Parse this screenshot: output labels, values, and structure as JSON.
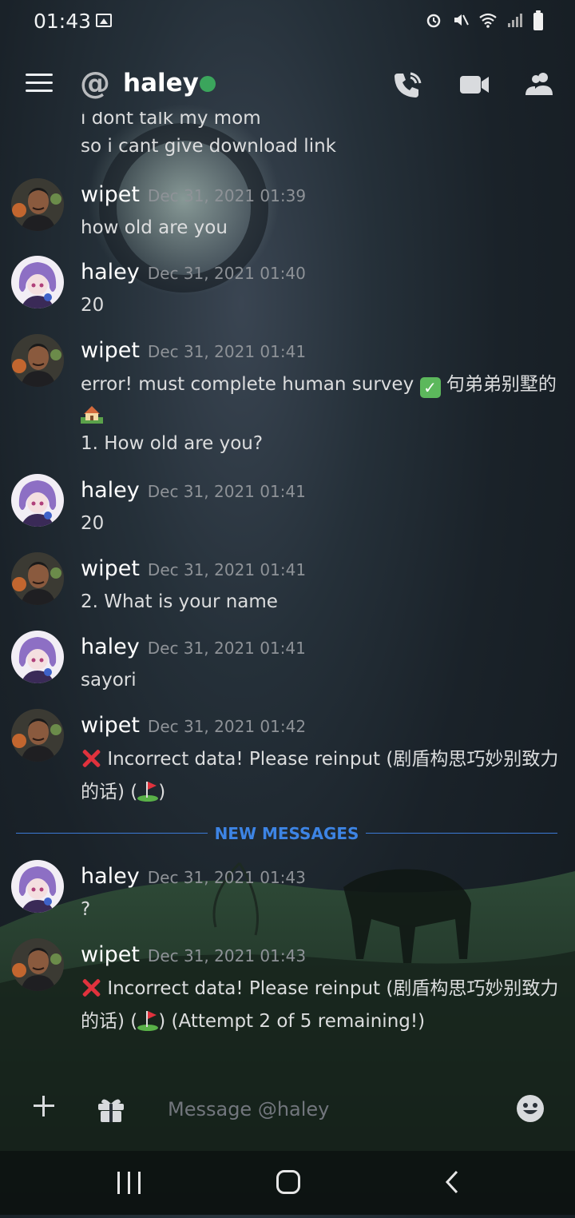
{
  "status_bar": {
    "time": "01:43"
  },
  "header": {
    "at_symbol": "@",
    "channel_name": "haley"
  },
  "partial_message": {
    "lines": [
      "i dont talk my mom",
      "so i cant give download link"
    ]
  },
  "messages": [
    {
      "author": "wipet",
      "timestamp": "Dec 31, 2021 01:39",
      "lines": [
        "how old are you"
      ]
    },
    {
      "author": "haley",
      "timestamp": "Dec 31, 2021 01:40",
      "lines": [
        "20"
      ]
    },
    {
      "author": "wipet",
      "timestamp": "Dec 31, 2021 01:41",
      "line1": "error! must complete human survey",
      "line1_cjk": "句弟弟别墅的",
      "line3": "1. How old are you?"
    },
    {
      "author": "haley",
      "timestamp": "Dec 31, 2021 01:41",
      "lines": [
        "20"
      ]
    },
    {
      "author": "wipet",
      "timestamp": "Dec 31, 2021 01:41",
      "lines": [
        "2. What is your name"
      ]
    },
    {
      "author": "haley",
      "timestamp": "Dec 31, 2021 01:41",
      "lines": [
        "sayori"
      ]
    },
    {
      "author": "wipet",
      "timestamp": "Dec 31, 2021 01:42",
      "line1": "Incorrect data! Please reinput (剧盾构思巧妙别致力",
      "line2_a": "的话) (",
      "line2_b": ")"
    },
    {
      "author": "haley",
      "timestamp": "Dec 31, 2021 01:43",
      "lines": [
        "?"
      ]
    },
    {
      "author": "wipet",
      "timestamp": "Dec 31, 2021 01:43",
      "line1": "Incorrect data! Please reinput (剧盾构思巧妙别致力",
      "line2_a": "的话) (",
      "line2_b": ") (Attempt 2 of 5 remaining!)"
    }
  ],
  "divider": {
    "label": "NEW MESSAGES"
  },
  "composer": {
    "placeholder": "Message @haley"
  },
  "icons": {
    "menu": "hamburger-menu-icon",
    "call": "phone-call-icon",
    "video": "video-camera-icon",
    "members": "members-icon",
    "add": "plus-icon",
    "gift": "gift-icon",
    "emoji": "emoji-icon"
  },
  "colors": {
    "online": "#3ba55c",
    "divider": "#3d84e4",
    "timestamp": "#8e9297"
  }
}
